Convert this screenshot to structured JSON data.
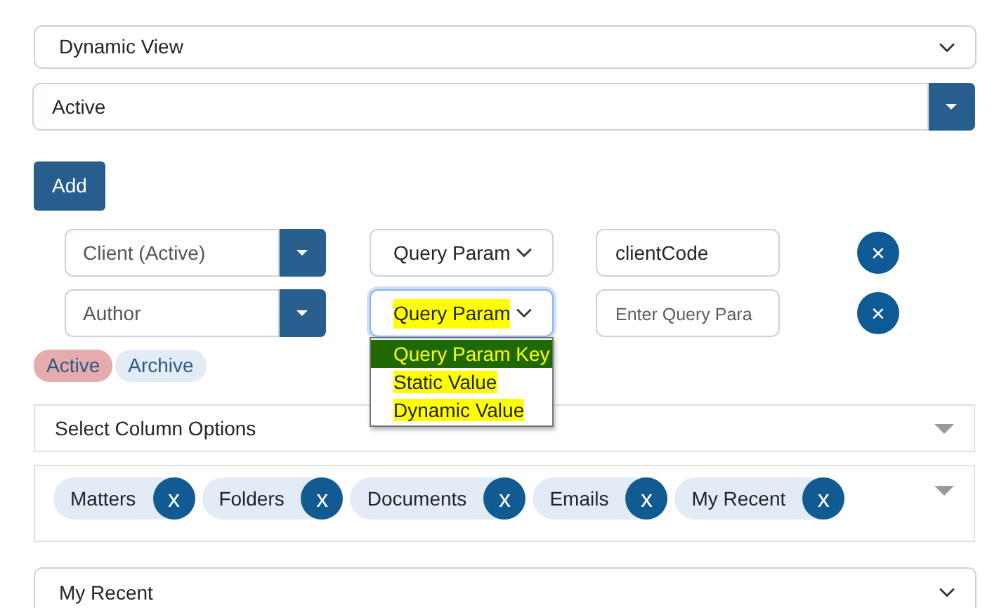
{
  "view_select": {
    "value": "Dynamic View"
  },
  "status_combo": {
    "value": "Active"
  },
  "add_button": "Add",
  "filters": [
    {
      "field": "Client (Active)",
      "source": "Query Param",
      "source_highlighted": false,
      "focused": false,
      "value": "clientCode",
      "remove": "×"
    },
    {
      "field": "Author",
      "source": "Query Param",
      "source_highlighted": true,
      "focused": true,
      "placeholder": "Enter Query Para",
      "remove": "×",
      "open_options": [
        {
          "label": "Query Param Key",
          "selected": true,
          "highlighted": true
        },
        {
          "label": "Static Value",
          "selected": false,
          "highlighted": true
        },
        {
          "label": "Dynamic Value",
          "selected": false,
          "highlighted": true
        }
      ]
    }
  ],
  "toggles": [
    {
      "label": "Active",
      "selected": true
    },
    {
      "label": "Archive",
      "selected": false
    }
  ],
  "column_select": {
    "placeholder": "Select Column Options"
  },
  "column_tags": [
    {
      "label": "Matters",
      "remove": "x"
    },
    {
      "label": "Folders",
      "remove": "x"
    },
    {
      "label": "Documents",
      "remove": "x"
    },
    {
      "label": "Emails",
      "remove": "x"
    },
    {
      "label": "My Recent",
      "remove": "x"
    }
  ],
  "bottom_select": {
    "value": "My Recent"
  }
}
